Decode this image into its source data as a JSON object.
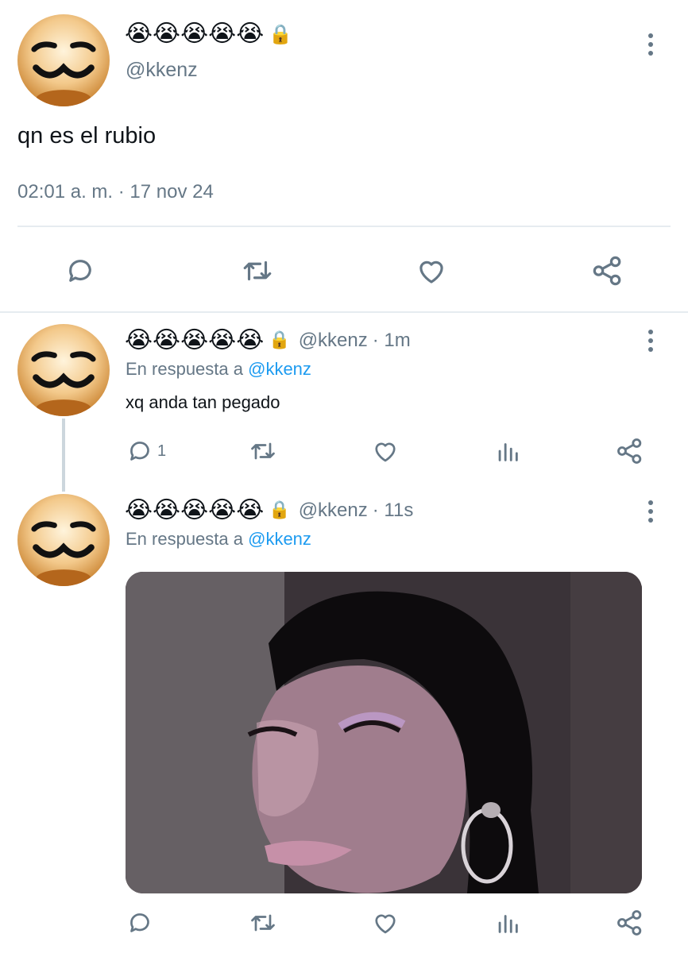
{
  "main_tweet": {
    "display_name": "😭😭😭😭😭",
    "lock": "🔒",
    "handle": "@kkenz",
    "text": "qn es el rubio",
    "timestamp": "02:01 a. m. · 17 nov 24"
  },
  "replies": [
    {
      "display_name": "😭😭😭😭😭",
      "lock": "🔒",
      "handle": "@kkenz",
      "time": "· 1m",
      "reply_prefix": "En respuesta a",
      "reply_to": "@kkenz",
      "text": "xq anda tan pegado",
      "reply_count": "1"
    },
    {
      "display_name": "😭😭😭😭😭",
      "lock": "🔒",
      "handle": "@kkenz",
      "time": "· 11s",
      "reply_prefix": "En respuesta a",
      "reply_to": "@kkenz",
      "media": "photo"
    }
  ],
  "icons": [
    "more-vertical-icon",
    "reply-icon",
    "retweet-icon",
    "like-icon",
    "views-icon",
    "share-icon",
    "lock-icon"
  ],
  "colors": {
    "text": "#0f1419",
    "secondary": "#657786",
    "link": "#1d9bf0",
    "divider": "#e6ecf0"
  }
}
